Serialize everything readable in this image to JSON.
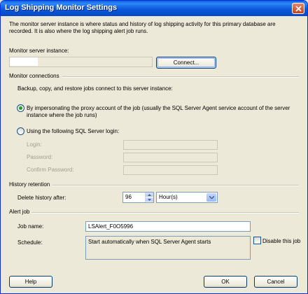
{
  "window": {
    "title": "Log Shipping Monitor Settings"
  },
  "intro": "The monitor server instance is where status and history of log shipping activity for this primary database are recorded. It is also where the log shipping alert job runs.",
  "monitor_server": {
    "label": "Monitor server instance:",
    "value": "",
    "connect_label": "Connect..."
  },
  "connections": {
    "group_label": "Monitor connections",
    "description": "Backup, copy, and restore jobs connect to this server instance:",
    "option_impersonate": "By impersonating the proxy account of the job (usually the SQL Server Agent service account of the server instance where the job runs)",
    "option_impersonate_selected": true,
    "option_sql_login": "Using the following SQL Server login:",
    "option_sql_login_selected": false,
    "login_label": "Login:",
    "password_label": "Password:",
    "confirm_password_label": "Confirm Password:"
  },
  "history": {
    "group_label": "History retention",
    "delete_label": "Delete history after:",
    "delete_value": "96",
    "unit_value": "Hour(s)"
  },
  "alert_job": {
    "group_label": "Alert job",
    "job_name_label": "Job name:",
    "job_name_value": "LSAlert_F0O5996",
    "schedule_label": "Schedule:",
    "schedule_value": "Start automatically when SQL Server Agent starts",
    "disable_label": "Disable this job",
    "disable_checked": false
  },
  "footer": {
    "help_label": "Help",
    "ok_label": "OK",
    "cancel_label": "Cancel"
  },
  "colors": {
    "titlebar": "#0b58dc",
    "dialog_bg": "#ece9d8",
    "radio_dot": "#21a121"
  }
}
